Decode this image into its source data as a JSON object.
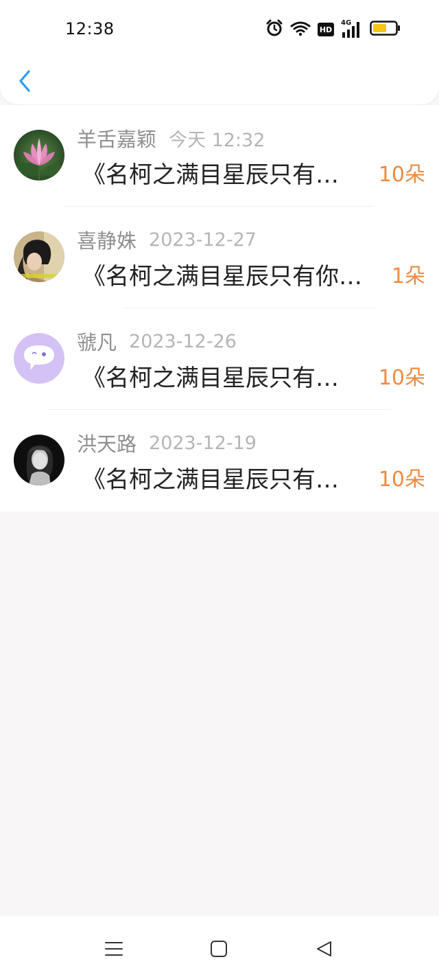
{
  "status_bar": {
    "time": "12:38",
    "icons": [
      "alarm-icon",
      "wifi-icon",
      "hd-icon",
      "signal-4g-icon",
      "battery-icon"
    ],
    "hd_label": "HD",
    "network_label": "4G",
    "battery_level": 0.6
  },
  "header": {
    "back_icon": "chevron-left-icon",
    "accent_color": "#2a9df4"
  },
  "items": [
    {
      "name": "羊舌嘉颖",
      "date": "今天 12:32",
      "title": "《名柯之满目星辰只有…",
      "count": "10朵",
      "avatar": "lotus-photo"
    },
    {
      "name": "喜静姝",
      "date": "2023-12-27",
      "title": "《名柯之满目星辰只有你…",
      "count": "1朵",
      "avatar": "girl-photo"
    },
    {
      "name": "虢凡",
      "date": "2023-12-26",
      "title": "《名柯之满目星辰只有…",
      "count": "10朵",
      "avatar": "default-chat-avatar"
    },
    {
      "name": "洪天路",
      "date": "2023-12-19",
      "title": "《名柯之满目星辰只有…",
      "count": "10朵",
      "avatar": "bw-portrait-photo"
    }
  ],
  "colors": {
    "count": "#ef8a3e",
    "name": "#8f8f8f",
    "date": "#b5b5b5",
    "background": "#f9f6f7"
  },
  "nav_bar": {
    "icons": [
      "menu-icon",
      "home-square-icon",
      "back-triangle-icon"
    ]
  }
}
